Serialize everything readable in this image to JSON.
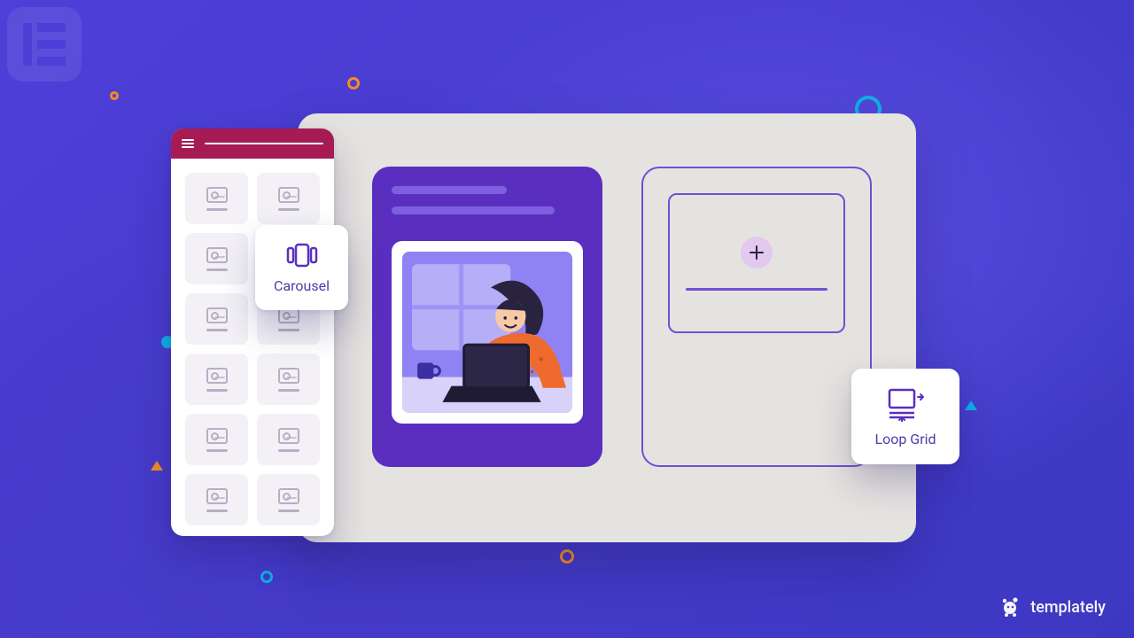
{
  "widgets": {
    "carousel": {
      "label": "Carousel"
    },
    "loop_grid": {
      "label": "Loop Grid"
    }
  },
  "brand": {
    "name": "templately"
  },
  "colors": {
    "background": "#4b3fd5",
    "canvas": "#e5e3e0",
    "accent_header": "#a61b54",
    "purple_card": "#5a2fc0",
    "outline": "#6f4fd6",
    "decor_orange": "#f68b1f",
    "decor_cyan": "#0fb0e6"
  }
}
